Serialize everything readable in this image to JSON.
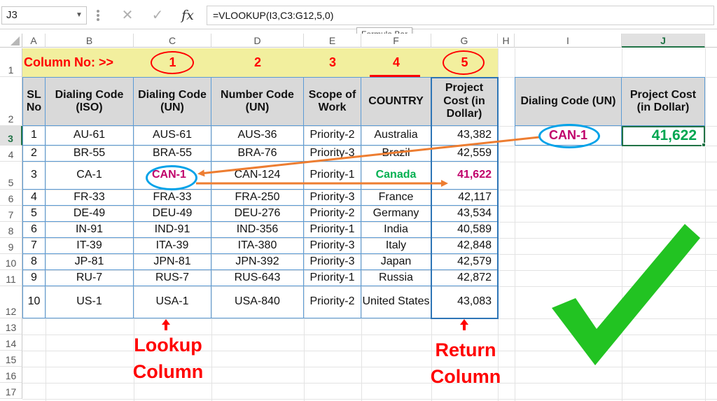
{
  "formula_bar": {
    "name_box": "J3",
    "name_box_icon": "dropdown-arrow-icon",
    "cancel_icon": "✕",
    "enter_icon": "✓",
    "fx_label": "fx",
    "formula": "=VLOOKUP(I3,C3:G12,5,0)",
    "tooltip": "Formula Bar"
  },
  "columns": [
    "A",
    "B",
    "C",
    "D",
    "E",
    "F",
    "G",
    "H",
    "I",
    "J"
  ],
  "rows": [
    "1",
    "2",
    "3",
    "4",
    "5",
    "6",
    "7",
    "8",
    "9",
    "10",
    "11",
    "12",
    "13",
    "14",
    "15",
    "16",
    "17"
  ],
  "column_numbers": {
    "label": "Column No: >>",
    "c": "1",
    "d": "2",
    "e": "3",
    "f": "4",
    "g": "5"
  },
  "table": {
    "headers": [
      "SL No",
      "Dialing Code (ISO)",
      "Dialing Code (UN)",
      "Number Code (UN)",
      "Scope of Work",
      "COUNTRY",
      "Project Cost (in Dollar)"
    ],
    "rows": [
      [
        "1",
        "AU-61",
        "AUS-61",
        "AUS-36",
        "Priority-2",
        "Australia",
        "43,382"
      ],
      [
        "2",
        "BR-55",
        "BRA-55",
        "BRA-76",
        "Priority-3",
        "Brazil",
        "42,559"
      ],
      [
        "3",
        "CA-1",
        "CAN-1",
        "CAN-124",
        "Priority-1",
        "Canada",
        "41,622"
      ],
      [
        "4",
        "FR-33",
        "FRA-33",
        "FRA-250",
        "Priority-3",
        "France",
        "42,117"
      ],
      [
        "5",
        "DE-49",
        "DEU-49",
        "DEU-276",
        "Priority-2",
        "Germany",
        "43,534"
      ],
      [
        "6",
        "IN-91",
        "IND-91",
        "IND-356",
        "Priority-1",
        "India",
        "40,589"
      ],
      [
        "7",
        "IT-39",
        "ITA-39",
        "ITA-380",
        "Priority-3",
        "Italy",
        "42,848"
      ],
      [
        "8",
        "JP-81",
        "JPN-81",
        "JPN-392",
        "Priority-3",
        "Japan",
        "42,579"
      ],
      [
        "9",
        "RU-7",
        "RUS-7",
        "RUS-643",
        "Priority-1",
        "Russia",
        "42,872"
      ],
      [
        "10",
        "US-1",
        "USA-1",
        "USA-840",
        "Priority-2",
        "United States",
        "43,083"
      ]
    ]
  },
  "lookup": {
    "header_i": "Dialing Code (UN)",
    "header_j": "Project Cost (in Dollar)",
    "value_i": "CAN-1",
    "value_j": "41,622"
  },
  "annotations": {
    "lookup_column": "Lookup Column",
    "return_column": "Return Column",
    "checkmark_icon": "checkmark-icon",
    "arrow_icon": "up-arrow-icon"
  },
  "colors": {
    "accent_red": "#ff0000",
    "highlight_magenta": "#c0006a",
    "country_green": "#00b050",
    "result_green": "#00a651",
    "circle_blue": "#00a2e8",
    "arrow_orange": "#ed7d31",
    "band_yellow": "#f2ef9e",
    "header_gray": "#d9d9d9",
    "table_border": "#5b9bd5",
    "check_green": "#22c322"
  }
}
